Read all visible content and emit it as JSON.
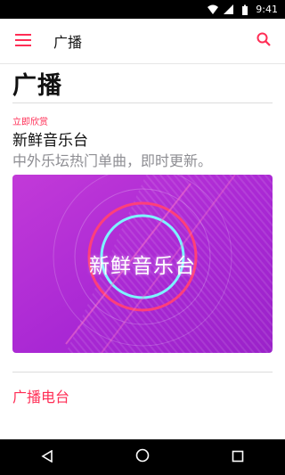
{
  "status_bar": {
    "time": "9:41"
  },
  "app_bar": {
    "title": "广播"
  },
  "page": {
    "title": "广播"
  },
  "featured": {
    "eyebrow": "立即欣赏",
    "title": "新鲜音乐台",
    "subtitle": "中外乐坛热门单曲，即时更新。",
    "card_label": "新鲜音乐台"
  },
  "sections": {
    "radio_stations": "广播电台"
  },
  "colors": {
    "accent": "#ff2d55",
    "card_purple": "#b12ad6"
  },
  "icons": {
    "menu": "hamburger-menu-icon",
    "search": "search-icon",
    "back": "back-triangle-icon",
    "home": "home-circle-icon",
    "recents": "recents-square-icon"
  }
}
